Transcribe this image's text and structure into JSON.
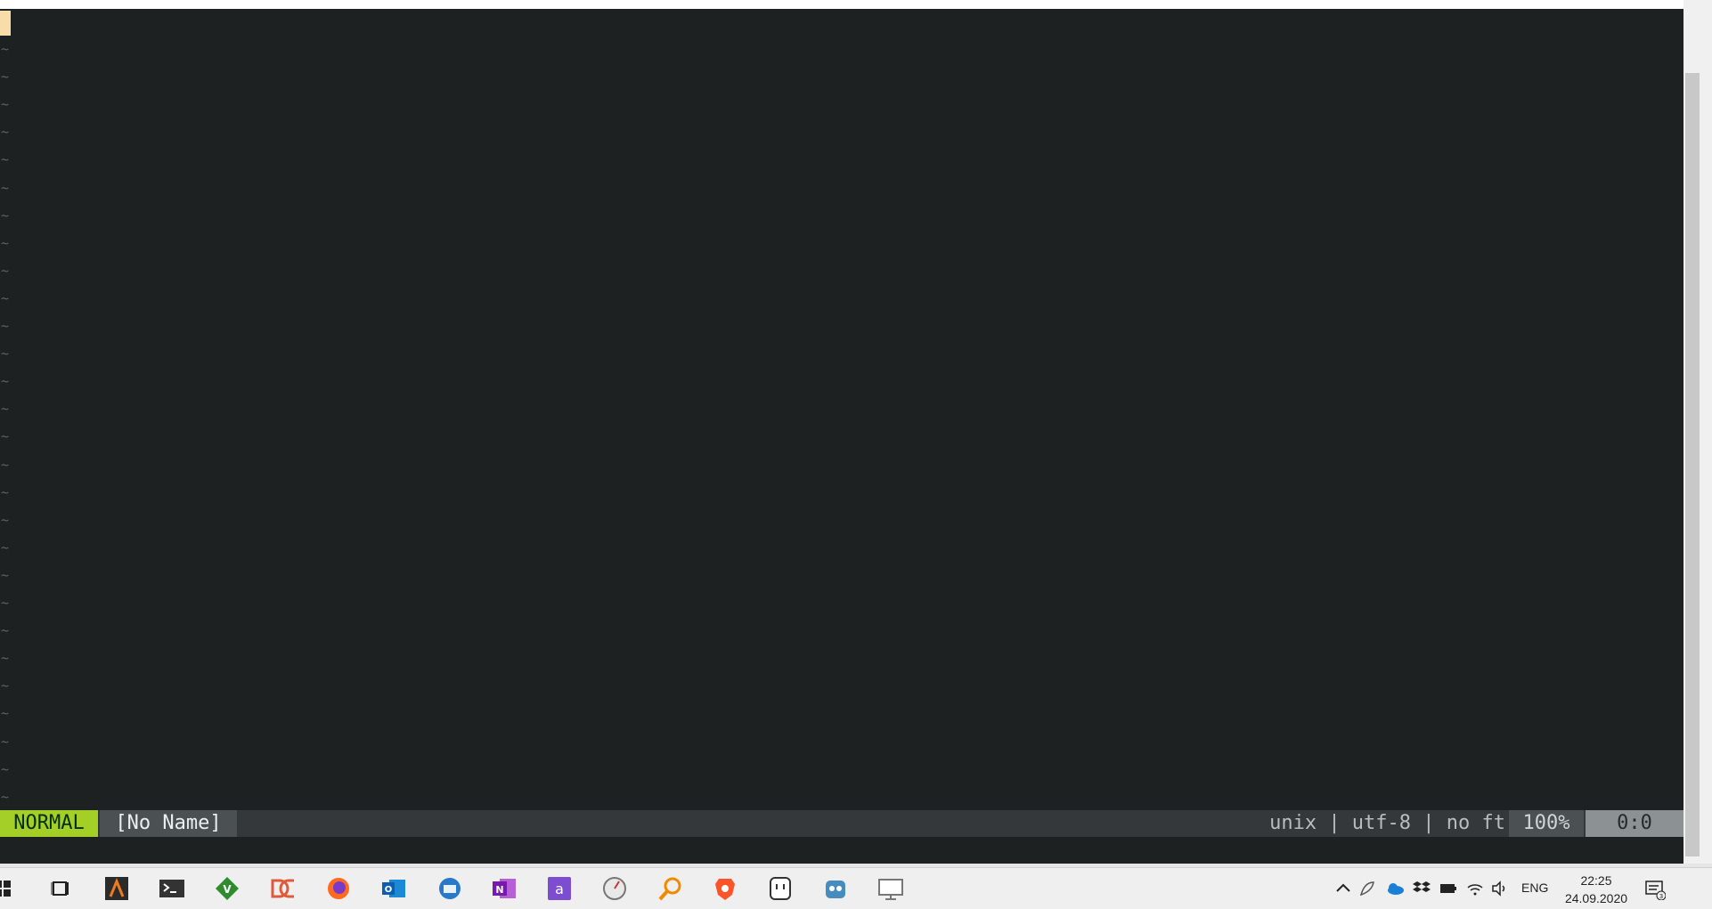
{
  "editor": {
    "empty_line_marker": "~",
    "colors": {
      "background": "#1e2122",
      "cursor": "#f7ddaa",
      "mode_bg": "#a4cf26",
      "statusline_bg": "#34383a"
    }
  },
  "statusline": {
    "mode": "NORMAL",
    "filename": "[No Name]",
    "fileinfo": "unix | utf-8 | no ft",
    "percent": "100%",
    "position": "0:0"
  },
  "taskbar": {
    "apps": [
      {
        "name": "start",
        "icon": "windows-start-icon"
      },
      {
        "name": "task-view",
        "icon": "task-view-icon"
      },
      {
        "name": "ide",
        "icon": "ide-a-icon"
      },
      {
        "name": "terminal",
        "icon": "terminal-icon"
      },
      {
        "name": "gvim",
        "icon": "gvim-icon",
        "active": true
      },
      {
        "name": "doublecmd",
        "icon": "double-commander-icon"
      },
      {
        "name": "firefox",
        "icon": "firefox-icon"
      },
      {
        "name": "outlook",
        "icon": "outlook-icon"
      },
      {
        "name": "thunderbird",
        "icon": "thunderbird-icon"
      },
      {
        "name": "onenote",
        "icon": "onenote-icon"
      },
      {
        "name": "app-a",
        "icon": "purple-a-app-icon"
      },
      {
        "name": "compass",
        "icon": "compass-icon"
      },
      {
        "name": "search",
        "icon": "magnifier-icon"
      },
      {
        "name": "brave",
        "icon": "brave-icon"
      },
      {
        "name": "notes",
        "icon": "robot-face-icon"
      },
      {
        "name": "godot",
        "icon": "godot-icon"
      },
      {
        "name": "remote",
        "icon": "remote-display-icon"
      }
    ],
    "tray": {
      "language": "ENG",
      "time": "22:25",
      "date": "24.09.2020",
      "notification_count": "3"
    }
  }
}
